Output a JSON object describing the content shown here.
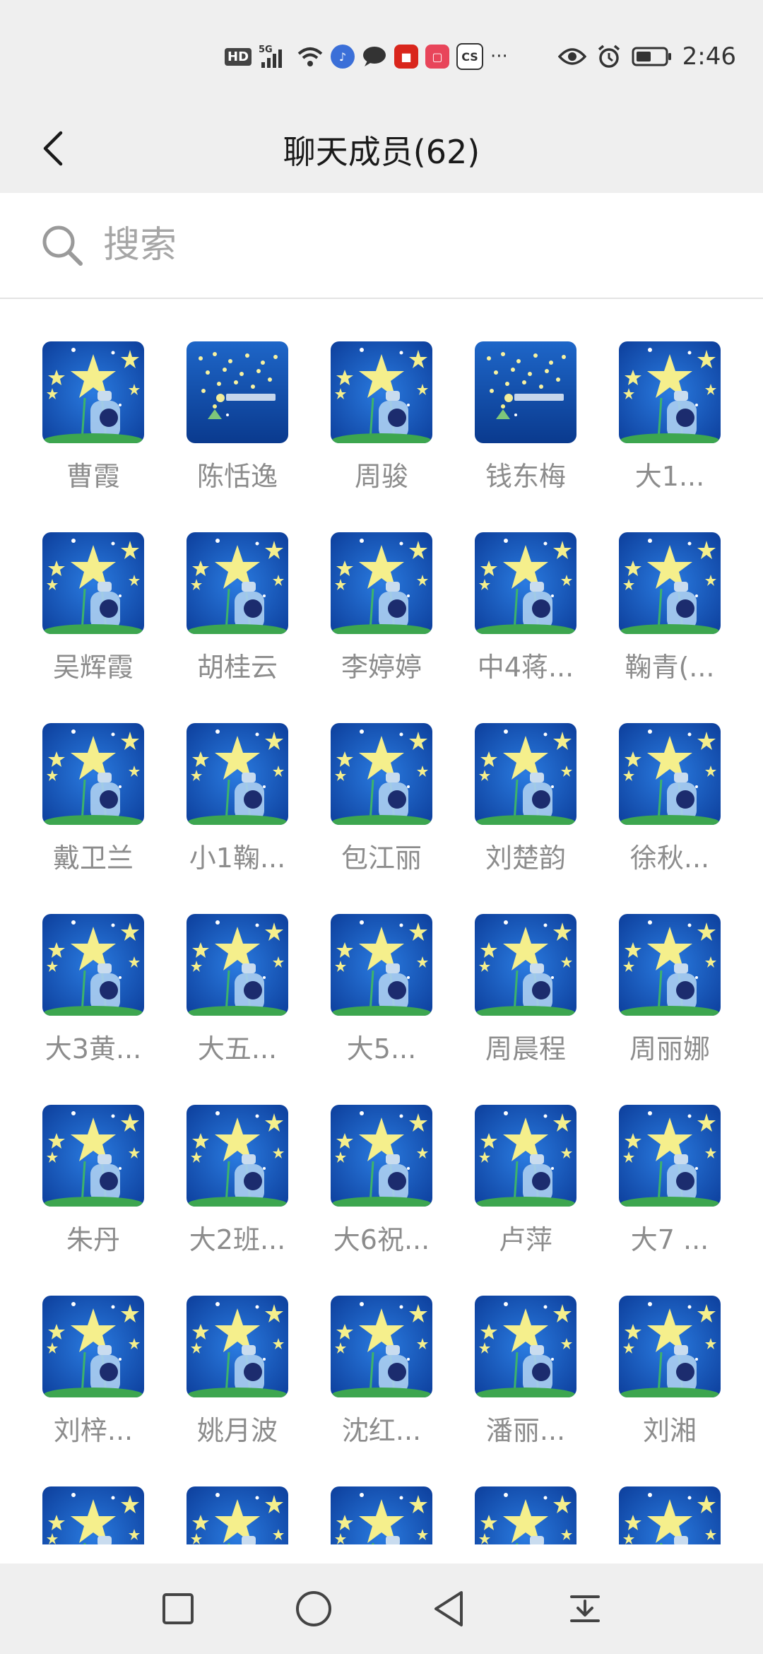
{
  "status_bar": {
    "time": "2:46",
    "network": "5G",
    "hd": "HD",
    "app_badge": "CS",
    "overflow": "···",
    "icons": [
      "hd-icon",
      "signal-icon",
      "wifi-icon",
      "music-icon",
      "chat-icon",
      "app-red-icon",
      "app-pink-icon",
      "cs-icon",
      "more-icon",
      "eye-icon",
      "alarm-icon",
      "battery-icon"
    ]
  },
  "header": {
    "title": "聊天成员(62)",
    "back_icon": "chevron-left-icon"
  },
  "search": {
    "placeholder": "搜索",
    "icon": "search-icon"
  },
  "members": [
    {
      "name": "曹霞",
      "avatar": "star-bottle"
    },
    {
      "name": "陈恬逸",
      "avatar": "night-sky"
    },
    {
      "name": "周骏",
      "avatar": "star-bottle"
    },
    {
      "name": "钱东梅",
      "avatar": "night-sky"
    },
    {
      "name": "大1...",
      "avatar": "star-bottle"
    },
    {
      "name": "吴辉霞",
      "avatar": "star-bottle"
    },
    {
      "name": "胡桂云",
      "avatar": "star-bottle"
    },
    {
      "name": "李婷婷",
      "avatar": "star-bottle"
    },
    {
      "name": "中4蒋...",
      "avatar": "star-bottle"
    },
    {
      "name": "鞠青(...",
      "avatar": "star-bottle"
    },
    {
      "name": "戴卫兰",
      "avatar": "star-bottle"
    },
    {
      "name": "小1鞠...",
      "avatar": "star-bottle"
    },
    {
      "name": "包江丽",
      "avatar": "star-bottle"
    },
    {
      "name": "刘楚韵",
      "avatar": "star-bottle"
    },
    {
      "name": "徐秋...",
      "avatar": "star-bottle"
    },
    {
      "name": "大3黄...",
      "avatar": "star-bottle"
    },
    {
      "name": "大五...",
      "avatar": "star-bottle"
    },
    {
      "name": "大5...",
      "avatar": "star-bottle"
    },
    {
      "name": "周晨程",
      "avatar": "star-bottle"
    },
    {
      "name": "周丽娜",
      "avatar": "star-bottle"
    },
    {
      "name": "朱丹",
      "avatar": "star-bottle"
    },
    {
      "name": "大2班...",
      "avatar": "star-bottle"
    },
    {
      "name": "大6祝...",
      "avatar": "star-bottle"
    },
    {
      "name": "卢萍",
      "avatar": "star-bottle"
    },
    {
      "name": "大7 ...",
      "avatar": "star-bottle"
    },
    {
      "name": "刘梓...",
      "avatar": "star-bottle"
    },
    {
      "name": "姚月波",
      "avatar": "star-bottle"
    },
    {
      "name": "沈红...",
      "avatar": "star-bottle"
    },
    {
      "name": "潘丽...",
      "avatar": "star-bottle"
    },
    {
      "name": "刘湘",
      "avatar": "star-bottle"
    },
    {
      "name": "",
      "avatar": "star-bottle"
    },
    {
      "name": "",
      "avatar": "star-bottle"
    },
    {
      "name": "",
      "avatar": "star-bottle"
    },
    {
      "name": "",
      "avatar": "star-bottle"
    },
    {
      "name": "",
      "avatar": "star-bottle"
    }
  ],
  "nav_bar": {
    "buttons": [
      "recents-square-icon",
      "home-circle-icon",
      "back-triangle-icon",
      "notification-pull-icon"
    ]
  },
  "colors": {
    "background": "#ffffff",
    "bars": "#efefef",
    "name_text": "#8c8c8c",
    "avatar_blue": "#1558b8"
  }
}
